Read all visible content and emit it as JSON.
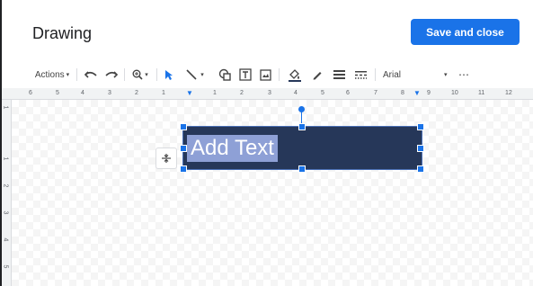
{
  "header": {
    "title": "Drawing",
    "save_label": "Save and close"
  },
  "toolbar": {
    "actions_label": "Actions",
    "font_name": "Arial",
    "more_label": "⋯"
  },
  "ruler": {
    "h_ticks": [
      "6",
      "5",
      "4",
      "3",
      "2",
      "1",
      "1",
      "2",
      "3",
      "4",
      "5",
      "6",
      "7",
      "8",
      "9",
      "10",
      "11",
      "12"
    ],
    "v_ticks": [
      "1",
      "1",
      "2",
      "3",
      "4",
      "5"
    ]
  },
  "shape": {
    "text": "Add Text",
    "fill_color": "#263759",
    "text_highlight": "#8ea0d6"
  },
  "accent": "#1a73e8"
}
